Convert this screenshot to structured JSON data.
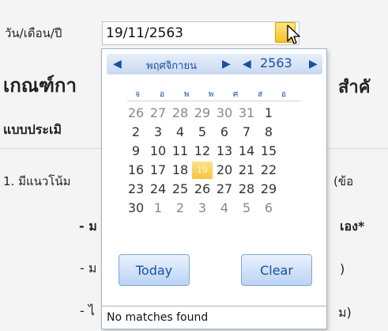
{
  "form": {
    "date_label": "วัน/เดือน/ปี",
    "date_value": "19/11/2563",
    "heading_left": "เกณฑ์กา",
    "heading_right": "สำคั",
    "sub_heading": "แบบประเมิ",
    "question_left": "1. มีแนวโน้ม",
    "question_right": "(ข้อ",
    "bullet1_left": "- ม",
    "bullet1_right": "เอง*",
    "bullet2_left": "- ม",
    "bullet2_right": ")",
    "bullet3_left": "- ไ",
    "bullet3_right": "ม)"
  },
  "calendar": {
    "prev_month_arrow": "◀",
    "next_month_arrow": "▶",
    "prev_year_arrow": "◀",
    "next_year_arrow": "▶",
    "month": "พฤศจิกายน",
    "year": "2563",
    "weekdays": [
      "จ",
      "อ",
      "พ",
      "พ",
      "ศ",
      "ส",
      "อ"
    ],
    "weeks": [
      [
        "26",
        "27",
        "28",
        "29",
        "30",
        "31",
        "1"
      ],
      [
        "2",
        "3",
        "4",
        "5",
        "6",
        "7",
        "8"
      ],
      [
        "9",
        "10",
        "11",
        "12",
        "13",
        "14",
        "15"
      ],
      [
        "16",
        "17",
        "18",
        "19",
        "20",
        "21",
        "22"
      ],
      [
        "23",
        "24",
        "25",
        "26",
        "27",
        "28",
        "29"
      ],
      [
        "30",
        "1",
        "2",
        "3",
        "4",
        "5",
        "6"
      ]
    ],
    "today_label": "Today",
    "clear_label": "Clear",
    "footer_text": "No matches found"
  },
  "colors": {
    "accent": "#1a4fa0",
    "today_highlight": "#f6c33e",
    "nav_bar": "#c9d9f0"
  },
  "icons": {
    "calendar_trigger": "calendar-icon",
    "cursor": "mouse-cursor-icon"
  }
}
